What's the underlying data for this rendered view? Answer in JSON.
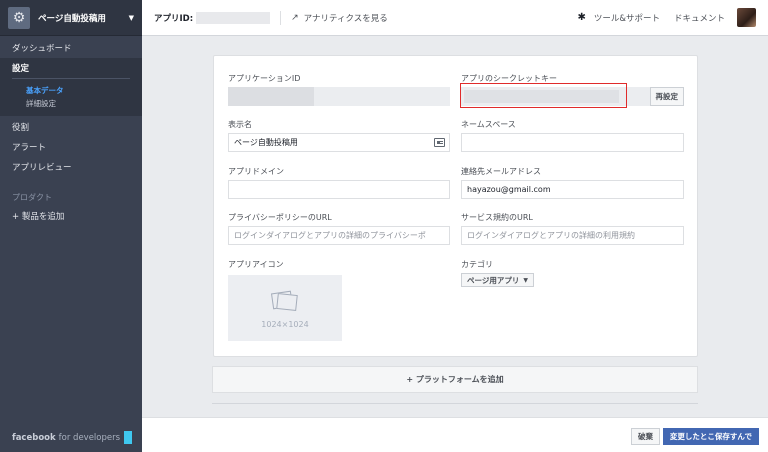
{
  "sidebar": {
    "app_name": "ページ自動投稿用",
    "items": {
      "dashboard": "ダッシュボード",
      "settings": "設定",
      "settings_basic": "基本データ",
      "settings_advanced": "詳細設定",
      "roles": "役割",
      "alerts": "アラート",
      "app_review": "アプリレビュー"
    },
    "products_label": "プロダクト",
    "add_product": "+ 製品を追加",
    "brand_bold": "facebook",
    "brand_rest": "for developers"
  },
  "topbar": {
    "app_id_label": "アプリID:",
    "analytics": "アナリティクスを見る",
    "tools_support": "ツール&サポート",
    "docs": "ドキュメント"
  },
  "form": {
    "app_id_label": "アプリケーションID",
    "app_secret_label": "アプリのシークレットキー",
    "reset_button": "再設定",
    "display_name_label": "表示名",
    "display_name_value": "ページ自動投稿用",
    "namespace_label": "ネームスペース",
    "namespace_value": "",
    "app_domains_label": "アプリドメイン",
    "app_domains_value": "",
    "contact_email_label": "連絡先メールアドレス",
    "contact_email_value": "hayazou@gmail.com",
    "privacy_url_label": "プライバシーポリシーのURL",
    "privacy_url_placeholder": "ログインダイアログとアプリの詳細のプライバシーポ",
    "terms_url_label": "サービス規約のURL",
    "terms_url_placeholder": "ログインダイアログとアプリの詳細の利用規約",
    "app_icon_label": "アプリアイコン",
    "app_icon_size": "1024×1024",
    "category_label": "カテゴリ",
    "category_value": "ページ用アプリ"
  },
  "add_platform": "+ プラットフォームを追加",
  "footer": {
    "discard": "破棄",
    "save": "変更したとこ保存すんで"
  },
  "colors": {
    "sidebar_bg": "#3a4151",
    "active_link": "#4aa3ff",
    "primary_button": "#4267b2",
    "highlight_border": "#e02b2b"
  }
}
